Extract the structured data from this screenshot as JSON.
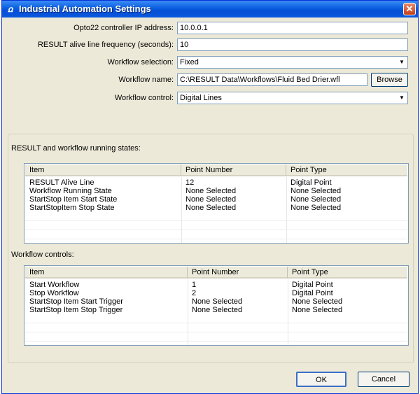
{
  "window": {
    "title": "Industrial Automation Settings",
    "icon_glyph": "ꭥ",
    "close_glyph": "✕"
  },
  "form": {
    "ip_label": "Opto22 controller IP address:",
    "ip_value": "10.0.0.1",
    "freq_label": "RESULT alive line frequency (seconds):",
    "freq_value": "10",
    "selection_label": "Workflow selection:",
    "selection_value": "Fixed",
    "name_label": "Workflow name:",
    "name_value": "C:\\RESULT Data\\Workflows\\Fluid Bed Drier.wfl",
    "browse_label": "Browse",
    "control_label": "Workflow control:",
    "control_value": "Digital Lines",
    "dropdown_arrow": "▼"
  },
  "states": {
    "label": "RESULT and workflow running states:",
    "columns": [
      "Item",
      "Point Number",
      "Point Type"
    ],
    "rows": [
      [
        "RESULT Alive Line",
        "12",
        "Digital Point"
      ],
      [
        "Workflow Running State",
        "None Selected",
        "None Selected"
      ],
      [
        "StartStop Item Start State",
        "None Selected",
        "None Selected"
      ],
      [
        "StartStopItem Stop State",
        "None Selected",
        "None Selected"
      ]
    ]
  },
  "controls": {
    "label": "Workflow controls:",
    "columns": [
      "Item",
      "Point Number",
      "Point Type"
    ],
    "rows": [
      [
        "Start Workflow",
        "1",
        "Digital Point"
      ],
      [
        "Stop Workflow",
        "2",
        "Digital Point"
      ],
      [
        "StartStop Item Start Trigger",
        "None Selected",
        "None Selected"
      ],
      [
        "StartStop Item Stop Trigger",
        "None Selected",
        "None Selected"
      ]
    ]
  },
  "footer": {
    "ok_label": "OK",
    "cancel_label": "Cancel"
  }
}
